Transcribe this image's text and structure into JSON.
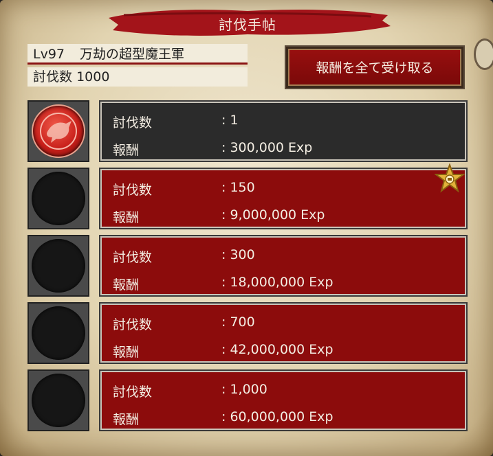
{
  "header": {
    "title": "討伐手帖"
  },
  "boss": {
    "level": "Lv97",
    "name": "万劫の超型魔王軍",
    "kills_label": "討伐数",
    "kills_value": "1000"
  },
  "claim_all_button": "報酬を全て受け取る",
  "rewards": [
    {
      "kills_label": "討伐数",
      "kills": ": 1",
      "reward_label": "報酬",
      "reward": ": 300,000 Exp",
      "claimed": true
    },
    {
      "kills_label": "討伐数",
      "kills": ": 150",
      "reward_label": "報酬",
      "reward": ": 9,000,000 Exp",
      "claimed": false
    },
    {
      "kills_label": "討伐数",
      "kills": ": 300",
      "reward_label": "報酬",
      "reward": ": 18,000,000 Exp",
      "claimed": false
    },
    {
      "kills_label": "討伐数",
      "kills": ": 700",
      "reward_label": "報酬",
      "reward": ": 42,000,000 Exp",
      "claimed": false
    },
    {
      "kills_label": "討伐数",
      "kills": ": 1,000",
      "reward_label": "報酬",
      "reward": ": 60,000,000 Exp",
      "claimed": false
    }
  ],
  "icons": {
    "medal": "red-seal-medal-icon",
    "badge": "gold-star-badge-icon"
  },
  "colors": {
    "accent_red": "#8c0c0c",
    "claimed_row": "#2b2b2b",
    "parchment": "#e2d4b1"
  }
}
